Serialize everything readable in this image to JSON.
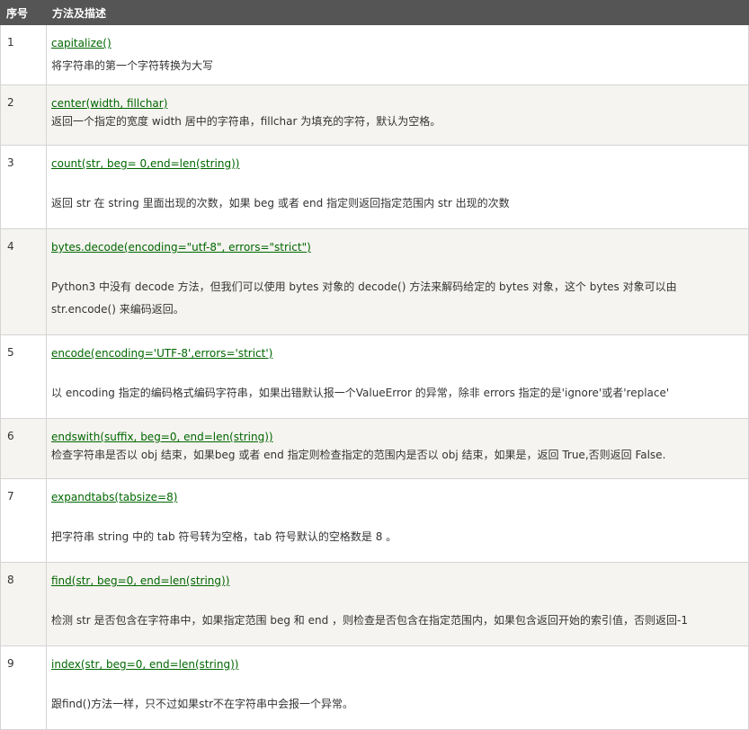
{
  "header": {
    "col_index": "序号",
    "col_method": "方法及描述"
  },
  "rows": [
    {
      "index": "1",
      "method": "capitalize()",
      "desc": [
        "将字符串的第一个字符转换为大写"
      ]
    },
    {
      "index": "2",
      "method": "center(width, fillchar)",
      "desc": [
        "返回一个指定的宽度 width 居中的字符串，fillchar 为填充的字符，默认为空格。"
      ]
    },
    {
      "index": "3",
      "method": "count(str, beg= 0,end=len(string))",
      "desc": [
        "返回 str 在 string 里面出现的次数，如果 beg 或者 end 指定则返回指定范围内 str 出现的次数"
      ]
    },
    {
      "index": "4",
      "method": "bytes.decode(encoding=\"utf-8\", errors=\"strict\")",
      "desc": [
        "Python3 中没有 decode 方法，但我们可以使用 bytes 对象的 decode() 方法来解码给定的 bytes 对象，这个 bytes 对象可以由",
        "str.encode() 来编码返回。"
      ]
    },
    {
      "index": "5",
      "method": "encode(encoding='UTF-8',errors='strict')",
      "desc": [
        "以 encoding 指定的编码格式编码字符串，如果出错默认报一个ValueError 的异常，除非 errors 指定的是'ignore'或者'replace'"
      ]
    },
    {
      "index": "6",
      "method": "endswith(suffix, beg=0, end=len(string))",
      "desc": [
        "检查字符串是否以 obj 结束，如果beg 或者 end 指定则检查指定的范围内是否以 obj 结束，如果是，返回 True,否则返回 False."
      ]
    },
    {
      "index": "7",
      "method": "expandtabs(tabsize=8)",
      "desc": [
        "把字符串 string 中的 tab 符号转为空格，tab 符号默认的空格数是 8 。"
      ]
    },
    {
      "index": "8",
      "method": "find(str, beg=0, end=len(string))",
      "desc": [
        "检测 str 是否包含在字符串中，如果指定范围 beg 和 end ，则检查是否包含在指定范围内，如果包含返回开始的索引值，否则返回-1"
      ]
    },
    {
      "index": "9",
      "method": "index(str, beg=0, end=len(string))",
      "desc": [
        "跟find()方法一样，只不过如果str不在字符串中会报一个异常。"
      ]
    }
  ]
}
